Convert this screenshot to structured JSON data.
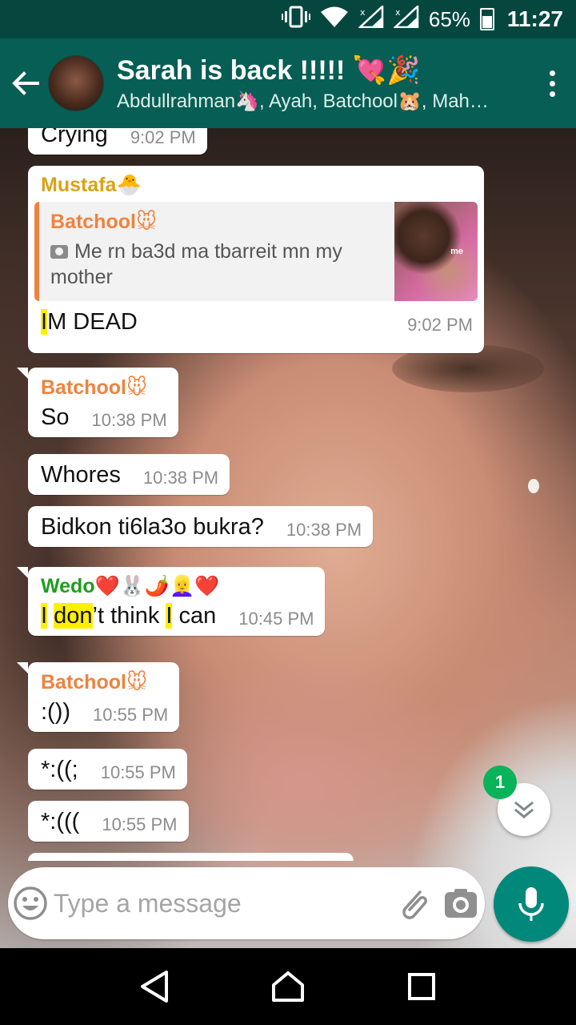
{
  "status_bar": {
    "battery_percent": "65%",
    "time": "11:27",
    "icons": [
      "vibrate-icon",
      "wifi-icon",
      "signal-1-icon",
      "signal-2-icon",
      "battery-icon"
    ]
  },
  "app_bar": {
    "title": "Sarah is back !!!!! 💘🎉",
    "members": "Abdullrahman🦄, Ayah, Batchool🐹, Mah…"
  },
  "messages": {
    "m0": {
      "text": "Crying",
      "time": "9:02 PM"
    },
    "m1": {
      "sender": "Mustafa🐣",
      "sender_color": "#d8a418",
      "quote": {
        "sender": "Batchool🐭",
        "text": "Me rn ba3d ma tbarreit mn my mother",
        "thumb_label": "me"
      },
      "text_hl": "I",
      "text_rest": "M DEAD",
      "time": "9:02 PM"
    },
    "m2": {
      "sender": "Batchool🐭",
      "sender_color": "#f0823d",
      "text": "So",
      "time": "10:38 PM"
    },
    "m3": {
      "text": "Whores",
      "time": "10:38 PM"
    },
    "m4": {
      "text": "Bidkon ti6la3o bukra?",
      "time": "10:38 PM"
    },
    "m5": {
      "sender": "Wedo❤️🐰🌶️👱‍♀️❤️",
      "sender_color": "#1e9e1e",
      "parts": {
        "p1": "I",
        "p2": " ",
        "p3": "don",
        "p4": "’t think ",
        "p5": "I",
        "p6": " can"
      },
      "time": "10:45 PM"
    },
    "m6": {
      "sender": "Batchool🐭",
      "sender_color": "#f0823d",
      "text": ":())",
      "time": "10:55 PM"
    },
    "m7": {
      "text": "*:((;",
      "time": "10:55 PM"
    },
    "m8": {
      "text": "*:(((",
      "time": "10:55 PM"
    }
  },
  "scroll": {
    "unread_count": "1"
  },
  "composer": {
    "placeholder": "Type a message"
  },
  "colors": {
    "header": "#075e54",
    "status_bar": "#05473f",
    "fab": "#00897b",
    "badge": "#09b35a",
    "highlight": "#fff000"
  }
}
